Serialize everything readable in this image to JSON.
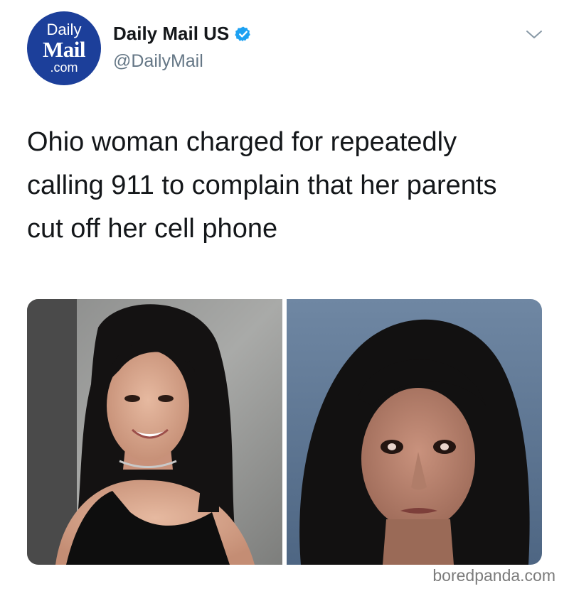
{
  "tweet": {
    "avatar": {
      "line1": "Daily",
      "line2": "Mail",
      "line3": ".com",
      "color": "#1c3f9a"
    },
    "display_name": "Daily Mail US",
    "verified": true,
    "handle": "@DailyMail",
    "text": "Ohio woman charged for repeatedly calling 911 to complain that her parents cut off her cell phone",
    "menu_icon": "chevron-down-icon",
    "media": [
      {
        "description_icon": "portrait-photo",
        "background": "#6f7070"
      },
      {
        "description_icon": "mugshot-photo",
        "background": "#5d7590"
      }
    ]
  },
  "watermark": "boredpanda.com",
  "colors": {
    "verified": "#1da1f2",
    "handle": "#657786",
    "text": "#14171a"
  }
}
